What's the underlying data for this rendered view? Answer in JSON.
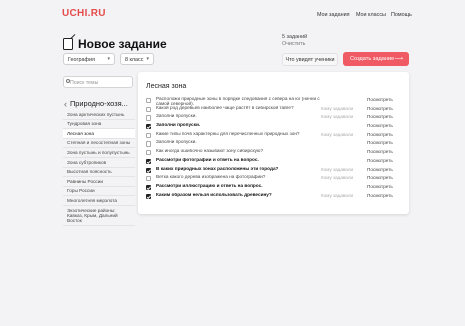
{
  "brand": {
    "logo": "UCHI.RU"
  },
  "topnav": {
    "my_tasks": "Мои задания",
    "my_classes": "Мои классы",
    "help": "Помощь"
  },
  "header": {
    "title": "Новое задание",
    "task_count": "5 заданий",
    "clear": "Очистить"
  },
  "filters": {
    "subject": "География",
    "grade": "8 класс",
    "audience_button": "Что увидят ученики",
    "create_button": "Создать задание"
  },
  "sidebar": {
    "search_placeholder": "Поиск темы",
    "current_topic": "Природно-хозя...",
    "items": [
      {
        "label": "Зона арктических пустынь"
      },
      {
        "label": "Тундровая зона"
      },
      {
        "label": "Лесная зона"
      },
      {
        "label": "Степная и лесостепная зоны"
      },
      {
        "label": "Зона пустынь и полупустынь"
      },
      {
        "label": "Зона субтропиков"
      },
      {
        "label": "Высотная поясность"
      },
      {
        "label": "Равнины России"
      },
      {
        "label": "Горы России"
      },
      {
        "label": "Многолетняя мерзлота"
      },
      {
        "label": "Экзотические районы: Кавказ, Крым, Дальний Восток"
      }
    ]
  },
  "content": {
    "section_title": "Лесная зона",
    "view_label": "Посмотреть",
    "assigned_label": "Кому задавали",
    "tasks": [
      {
        "text": "Расположи природные зоны в порядке следования с севера на юг (начни с самой северной).",
        "checked": false,
        "assigned": false
      },
      {
        "text": "Какой род деревьев наиболее чаще растёт в сибирской тайге?",
        "checked": false,
        "assigned": true
      },
      {
        "text": "Заполни пропуски.",
        "checked": false,
        "assigned": true
      },
      {
        "text": "Заполни пропуски.",
        "checked": true,
        "assigned": false
      },
      {
        "text": "Какие типы почв характерны для перечисленных природных зон?",
        "checked": false,
        "assigned": true
      },
      {
        "text": "Заполни пропуски.",
        "checked": false,
        "assigned": false
      },
      {
        "text": "Как иногда ошибочно называют зону сибирскую?",
        "checked": false,
        "assigned": false
      },
      {
        "text": "Рассмотри фотографии и ответь на вопрос.",
        "checked": true,
        "assigned": false
      },
      {
        "text": "В каких природных зонах расположены эти города?",
        "checked": true,
        "assigned": true
      },
      {
        "text": "Ветка какого дерева изображена на фотографии?",
        "checked": false,
        "assigned": true
      },
      {
        "text": "Рассмотри иллюстрацию и ответь на вопрос.",
        "checked": true,
        "assigned": false
      },
      {
        "text": "Каким образом нельзя использовать древесину?",
        "checked": true,
        "assigned": true
      }
    ]
  },
  "colors": {
    "brand_red": "#e54b4b",
    "create_button": "#ef5a64",
    "background": "#f3f3f5"
  },
  "icons": {
    "document": "document-icon",
    "search": "search-icon",
    "chevron": "chevron-down-icon",
    "back": "chevron-left-icon",
    "arrow": "arrow-right-icon"
  }
}
